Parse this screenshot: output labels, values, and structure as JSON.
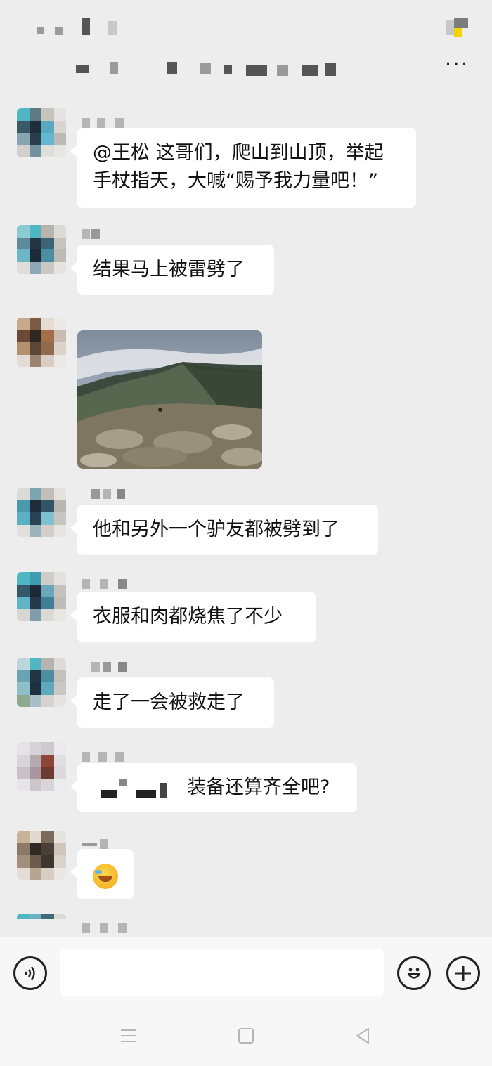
{
  "header": {
    "more_label": "···"
  },
  "messages": [
    {
      "type": "text",
      "lines": [
        "@王松 这哥们，爬山到山顶，举起",
        "手杖指天，大喊“赐予我力量吧！”"
      ]
    },
    {
      "type": "text",
      "lines": [
        "结果马上被雷劈了"
      ]
    },
    {
      "type": "image",
      "content": "mountain-photo"
    },
    {
      "type": "text",
      "lines": [
        "他和另外一个驴友都被劈到了"
      ]
    },
    {
      "type": "text",
      "lines": [
        "衣服和肉都烧焦了不少"
      ]
    },
    {
      "type": "text",
      "lines": [
        "走了一会被救走了"
      ]
    },
    {
      "type": "text",
      "lines": [
        "装备还算齐全吧?"
      ]
    },
    {
      "type": "emoji",
      "content": "crying-laughing-emoji"
    }
  ],
  "input_bar": {
    "voice_icon": "voice-icon",
    "emoji_icon": "smiley-icon",
    "plus_icon": "plus-icon",
    "text_value": ""
  },
  "nav": {
    "menu_icon": "menu-icon",
    "home_icon": "home-square-icon",
    "back_icon": "back-triangle-icon"
  }
}
